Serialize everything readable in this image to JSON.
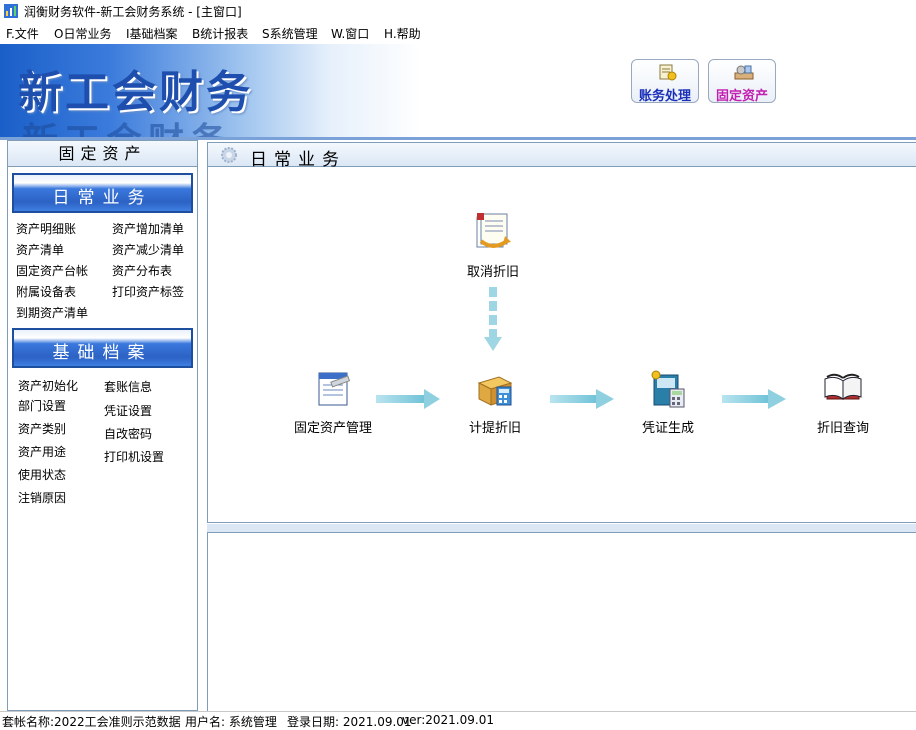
{
  "window": {
    "title": "润衡财务软件-新工会财务系统 - [主窗口]"
  },
  "menu": [
    {
      "label": "F.文件"
    },
    {
      "label": "O日常业务"
    },
    {
      "label": "I基础档案"
    },
    {
      "label": "B统计报表"
    },
    {
      "label": "S系统管理"
    },
    {
      "label": "W.窗口"
    },
    {
      "label": "H.帮助"
    }
  ],
  "banner": {
    "title": "新工会财务",
    "buttons": [
      {
        "label": "账务处理",
        "color": "#1a2fb8",
        "icon": "ledger-icon"
      },
      {
        "label": "固定资产",
        "color": "#c21fb0",
        "icon": "assets-icon"
      }
    ]
  },
  "sidebar": {
    "title": "固定资产",
    "daily": {
      "header": "日常业务",
      "items": [
        "资产明细账",
        "资产增加清单",
        "资产清单",
        "资产减少清单",
        "固定资产台帐",
        "资产分布表",
        "附属设备表",
        "打印资产标签",
        "到期资产清单"
      ]
    },
    "basic": {
      "header": "基础档案",
      "items": [
        "资产初始化",
        "套账信息",
        "部门设置",
        "凭证设置",
        "资产类别",
        "自改密码",
        "资产用途",
        "打印机设置",
        "使用状态",
        "注销原因"
      ]
    }
  },
  "main": {
    "title": "日常业务",
    "flow": {
      "cancel": "取消折旧",
      "asset_mgmt": "固定资产管理",
      "depreciate": "计提折旧",
      "voucher": "凭证生成",
      "query": "折旧查询"
    }
  },
  "status": {
    "account": "套帐名称:2022工会准则示范数据",
    "user": "用户名: 系统管理",
    "login_date": "登录日期: 2021.09.01",
    "version": "ver:2021.09.01"
  },
  "colors": {
    "accent": "#2c62c4",
    "border": "#7f9db9",
    "arrow": "#8fd0e0"
  }
}
